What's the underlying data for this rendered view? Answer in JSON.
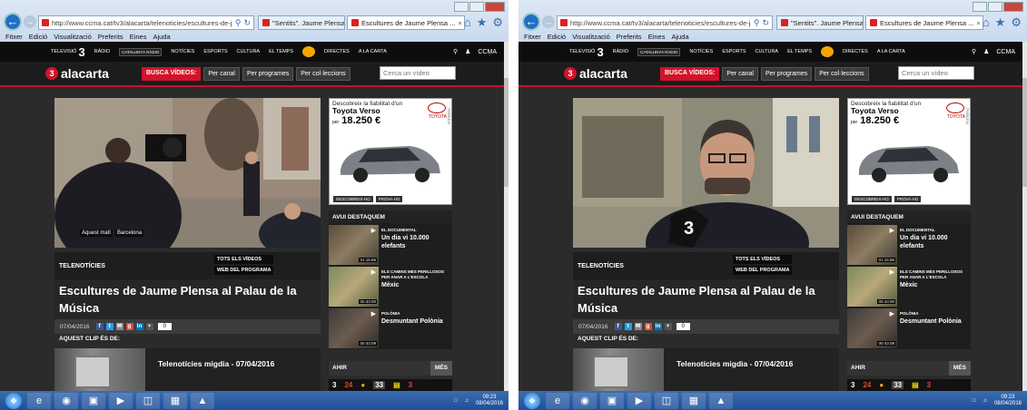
{
  "browser": {
    "url": "http://www.ccma.cat/tv3/alacarta/telenoticies/escultures-de-jaum",
    "tab1": "\"Sentits\". Jaume Plensa: \"Les m...",
    "tab2": "Escultures de Jaume Plensa ...",
    "menu": [
      "Fitxer",
      "Edició",
      "Visualització",
      "Preferits",
      "Eines",
      "Ajuda"
    ]
  },
  "topnav": {
    "tv3_label": "TELEVISIÓ",
    "tv3_mark": "3",
    "radio": "RÀDIO",
    "catradio": "CATALUNYA RÀDIO",
    "items": [
      "NOTÍCIES",
      "ESPORTS",
      "CULTURA",
      "EL TEMPS",
      "DIRECTES",
      "A LA CARTA"
    ],
    "ccma": "CCMA"
  },
  "header": {
    "logo": "alacarta",
    "logo_mark": "3",
    "busca_label": "BUSCA VÍDEOS:",
    "busca_buttons": [
      "Per canal",
      "Per programes",
      "Per col·leccions"
    ],
    "search_placeholder": "Cerca un vídeo"
  },
  "video": {
    "caption_location": "Aquest matí",
    "caption_city": "Barcelona"
  },
  "ad": {
    "tagline": "Descobreix la fiabilitat d'un",
    "model": "Toyota Verso",
    "price_prefix": "per",
    "price": "18.250 €",
    "brand": "TOYOTA",
    "publicitat": "Publicitat",
    "btn1": "DESCOBREIX-HO",
    "btn2": "PROVA-HO"
  },
  "info": {
    "category": "TELENOTÍCIES",
    "link_all": "TOTS ELS VÍDEOS",
    "link_web": "WEB DEL PROGRAMA"
  },
  "title": "Escultures de Jaume Plensa al Palau de la Música",
  "share": {
    "date": "07/04/2016",
    "count": "0"
  },
  "clip": {
    "label": "AQUEST CLIP ÉS DE:",
    "title": "Telenotícies migdia - 07/04/2016"
  },
  "sidebar": {
    "head": "AVUI DESTAQUEM",
    "items": [
      {
        "program": "EL DOCUMENTAL",
        "episode": "Un dia vi 10.000 elefants",
        "duration": "01:15:55"
      },
      {
        "program": "ELS CAMINS MÉS PERILLOSOS PER ANAR A L'ESCOLA",
        "episode": "Mèxic",
        "duration": "00:43:00"
      },
      {
        "program": "POLÒNIA",
        "episode": "Desmuntant Polònia",
        "duration": "00:43:09"
      }
    ],
    "ahir": "AHIR",
    "mes": "MÉS",
    "channels": [
      "3",
      "24",
      "33",
      "3"
    ]
  },
  "taskbar": {
    "time": "09:23",
    "date": "08/04/2016"
  }
}
